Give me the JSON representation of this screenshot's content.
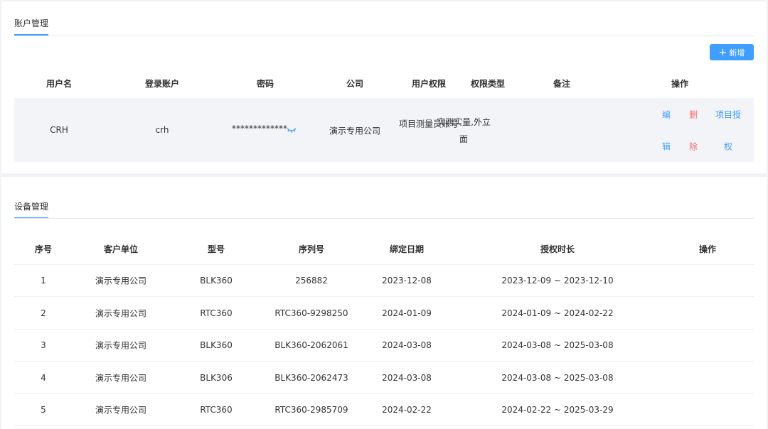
{
  "account": {
    "tab_label": "账户管理",
    "add_button_label": "新增",
    "columns": [
      "用户名",
      "登录账户",
      "密码",
      "公司",
      "用户权限",
      "权限类型",
      "备注",
      "操作"
    ],
    "rows": [
      {
        "username": "CRH",
        "login": "crh",
        "password": "*************",
        "company": "演示专用公司",
        "permission": "项目测量员账号",
        "permission_type": "实测实量,外立面",
        "remark": "",
        "actions": {
          "edit_top": "编",
          "edit_bottom": "辑",
          "delete_top": "删",
          "delete_bottom": "除",
          "grant_top": "项目授",
          "grant_bottom": "权"
        }
      }
    ]
  },
  "device": {
    "tab_label": "设备管理",
    "columns": [
      "序号",
      "客户单位",
      "型号",
      "序列号",
      "绑定日期",
      "授权时长",
      "操作"
    ],
    "rows": [
      {
        "index": "1",
        "client": "演示专用公司",
        "model": "BLK360",
        "serial": "256882",
        "bind_date": "2023-12-08",
        "auth_period": "2023-12-09 ~ 2023-12-10",
        "op": ""
      },
      {
        "index": "2",
        "client": "演示专用公司",
        "model": "RTC360",
        "serial": "RTC360-9298250",
        "bind_date": "2024-01-09",
        "auth_period": "2024-01-09 ~ 2024-02-22",
        "op": ""
      },
      {
        "index": "3",
        "client": "演示专用公司",
        "model": "BLK360",
        "serial": "BLK360-2062061",
        "bind_date": "2024-03-08",
        "auth_period": "2024-03-08 ~ 2025-03-08",
        "op": ""
      },
      {
        "index": "4",
        "client": "演示专用公司",
        "model": "BLK306",
        "serial": "BLK360-2062473",
        "bind_date": "2024-03-08",
        "auth_period": "2024-03-08 ~ 2025-03-08",
        "op": ""
      },
      {
        "index": "5",
        "client": "演示专用公司",
        "model": "RTC360",
        "serial": "RTC360-2985709",
        "bind_date": "2024-02-22",
        "auth_period": "2024-02-22 ~ 2025-03-29",
        "op": ""
      }
    ]
  },
  "icons": {
    "add": "plus-icon",
    "password_toggle": "eye-closed-icon"
  },
  "colors": {
    "accent": "#409eff",
    "danger": "#f56c6c",
    "row_highlight": "#f2f4f8"
  }
}
